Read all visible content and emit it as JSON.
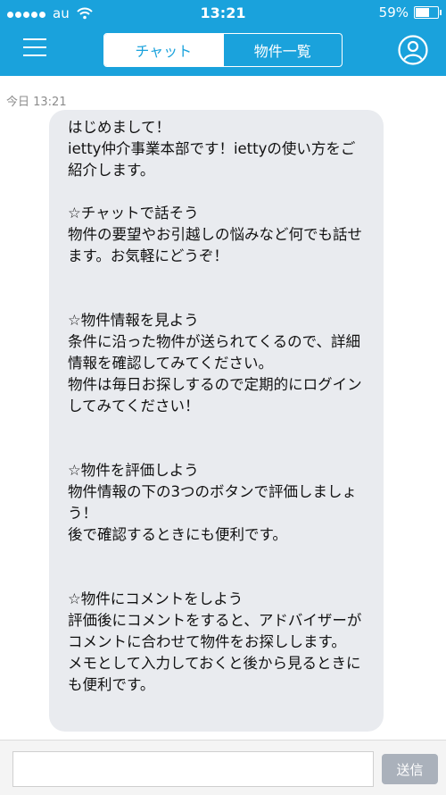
{
  "status_bar": {
    "carrier": "au",
    "time": "13:21",
    "battery": "59%",
    "battery_level": 0.59
  },
  "nav": {
    "menu_icon": "hamburger-menu-icon",
    "tabs": [
      {
        "label": "チャット",
        "active": true
      },
      {
        "label": "物件一覧",
        "active": false
      }
    ],
    "profile_icon": "user-profile-icon"
  },
  "chat": {
    "timestamp": "今日 13:21",
    "messages": [
      {
        "text": "はじめまして！\nietty仲介事業本部です！iettyの使い方をご紹介します。\n\n☆チャットで話そう\n物件の要望やお引越しの悩みなど何でも話せます。お気軽にどうぞ！\n\n\n☆物件情報を見よう\n条件に沿った物件が送られてくるので、詳細情報を確認してみてください。\n物件は毎日お探しするので定期的にログインしてみてください！\n\n\n☆物件を評価しよう\n物件情報の下の3つのボタンで評価しましょう！\n後で確認するときにも便利です。\n\n\n☆物件にコメントをしよう\n評価後にコメントをすると、アドバイザーがコメントに合わせて物件をお探しします。\nメモとして入力しておくと後から見るときにも便利です。"
      }
    ]
  },
  "composer": {
    "input_value": "",
    "input_placeholder": "",
    "send_label": "送信"
  },
  "colors": {
    "brand": "#1aa2dc",
    "bubble": "#e9ebef",
    "send_disabled": "#aab1bb"
  }
}
